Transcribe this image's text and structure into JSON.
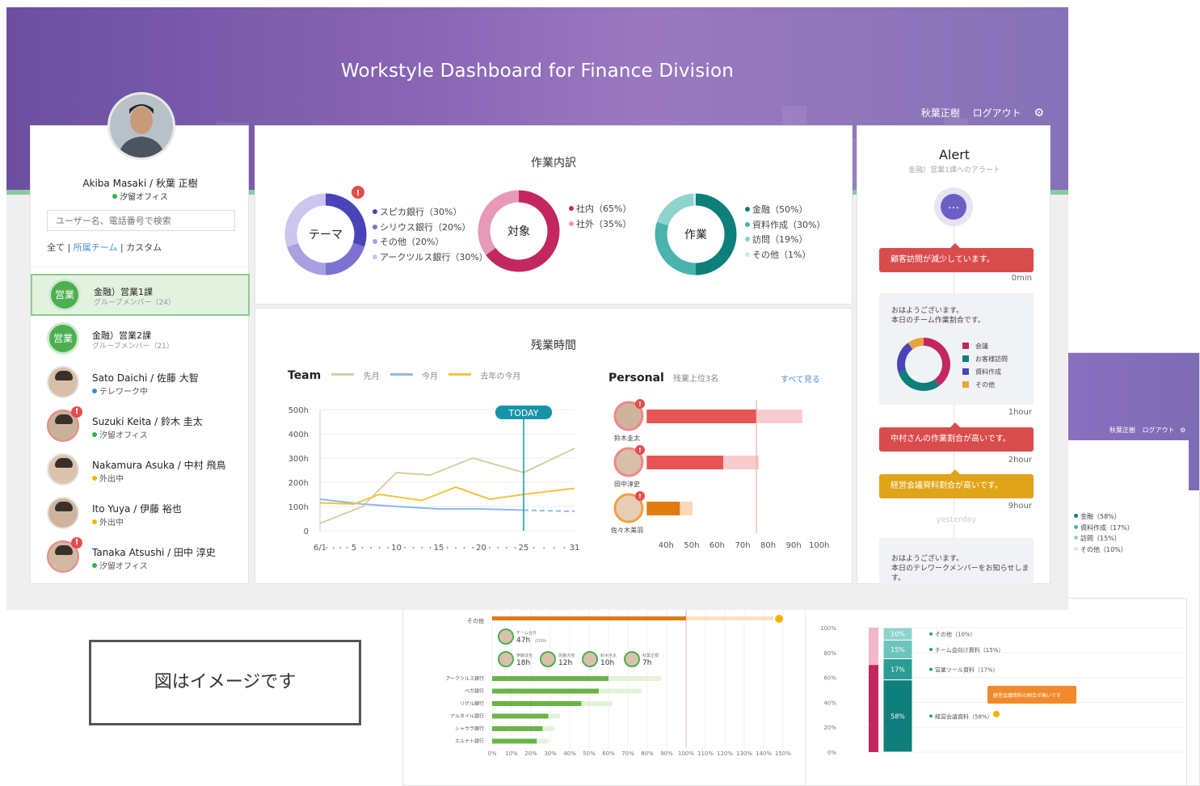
{
  "header": {
    "title": "Workstyle Dashboard for Finance Division",
    "user_name": "秋葉正樹",
    "logout": "ログアウト"
  },
  "profile": {
    "name": "Akiba Masaki / 秋葉 正樹",
    "status": "汐留オフィス",
    "search_placeholder": "ユーザー名、電話番号で検索",
    "filter_all": "全て",
    "filter_team": "所属チーム",
    "filter_custom": "カスタム",
    "sep": "|"
  },
  "groups": [
    {
      "icon": "営業",
      "name": "金融）営業1課",
      "members": "グループメンバー（24）"
    },
    {
      "icon": "営業",
      "name": "金融）営業2課",
      "members": "グループメンバー（21）"
    }
  ],
  "users": [
    {
      "name": "Sato Daichi / 佐藤 大智",
      "status": "テレワーク中",
      "status_color": "#2f8fd8",
      "alert": false
    },
    {
      "name": "Suzuki Keita / 鈴木 圭太",
      "status": "汐留オフィス",
      "status_color": "#2fb34a",
      "alert": true
    },
    {
      "name": "Nakamura Asuka / 中村 飛鳥",
      "status": "外出中",
      "status_color": "#f0b400",
      "alert": false
    },
    {
      "name": "Ito Yuya / 伊藤 裕也",
      "status": "外出中",
      "status_color": "#f0b400",
      "alert": false
    },
    {
      "name": "Tanaka Atsushi / 田中 淳史",
      "status": "汐留オフィス",
      "status_color": "#2fb34a",
      "alert": true
    }
  ],
  "work": {
    "title": "作業内訳",
    "donuts": [
      {
        "label": "テーマ",
        "alert": "!",
        "legend": [
          "スピカ銀行（30%）",
          "シリウス銀行（20%）",
          "その他（20%）",
          "アークツルス銀行（30%）"
        ],
        "colors": [
          "#4b44b8",
          "#7c72d1",
          "#a8a0e0",
          "#cbc6ee"
        ],
        "values": [
          30,
          20,
          20,
          30
        ]
      },
      {
        "label": "対象",
        "legend": [
          "社内（65%）",
          "社外（35%）"
        ],
        "colors": [
          "#c2275f",
          "#e69ab8"
        ],
        "values": [
          65,
          35
        ]
      },
      {
        "label": "作業",
        "legend": [
          "金融（50%）",
          "資料作成（30%）",
          "訪問（19%）",
          "その他（1%）"
        ],
        "colors": [
          "#0e7f7a",
          "#49b3ac",
          "#8fd3cd",
          "#c9ece8"
        ],
        "values": [
          50,
          30,
          19,
          1
        ]
      }
    ]
  },
  "overtime": {
    "title": "残業時間",
    "team_label": "Team",
    "legend": [
      "先月",
      "今月",
      "去年の今月"
    ],
    "today": "TODAY",
    "personal_label": "Personal",
    "personal_sub": "残業上位3名",
    "see_all": "すべて見る",
    "people": [
      "鈴木圭太",
      "田中淳史",
      "佐々木美羽"
    ],
    "person_alerts": [
      "!",
      "!",
      "!"
    ]
  },
  "chart_data": [
    {
      "type": "line",
      "title": "",
      "x_ticks": [
        "6/1",
        "5",
        "10",
        "15",
        "20",
        "25",
        "31"
      ],
      "y_ticks": [
        "500h",
        "400h",
        "300h",
        "200h",
        "100h",
        "0"
      ],
      "ylim": [
        0,
        500
      ],
      "xlim": [
        1,
        31
      ],
      "today_x": 25,
      "series": [
        {
          "name": "先月",
          "color": "#d5d0a0",
          "x": [
            1,
            6,
            10,
            14,
            19,
            25,
            31
          ],
          "values": [
            30,
            100,
            240,
            230,
            300,
            240,
            340
          ]
        },
        {
          "name": "今月",
          "color": "#8fb8ef",
          "x": [
            1,
            6,
            10,
            15,
            20,
            25
          ],
          "values": [
            130,
            110,
            100,
            90,
            90,
            85
          ],
          "dashed_to": {
            "x": 31,
            "value": 80
          }
        },
        {
          "name": "去年の今月",
          "color": "#f5c242",
          "x": [
            1,
            5,
            8,
            13,
            17,
            21,
            25,
            31
          ],
          "values": [
            115,
            110,
            150,
            125,
            180,
            130,
            150,
            175
          ]
        }
      ]
    },
    {
      "type": "bar",
      "orientation": "horizontal",
      "categories": [
        "鈴木圭太",
        "田中淳史",
        "佐々木美羽"
      ],
      "x_ticks": [
        "40h",
        "50h",
        "60h",
        "70h",
        "80h",
        "90h",
        "100h"
      ],
      "xlim": [
        38,
        102
      ],
      "series": [
        {
          "name": "actual",
          "colors": [
            "#e75454",
            "#e75454",
            "#e07b10"
          ],
          "values": [
            83,
            70,
            53
          ]
        },
        {
          "name": "projection",
          "colors": [
            "#f7cccc",
            "#f7cccc",
            "#fbd9b8"
          ],
          "values": [
            101,
            84,
            58
          ]
        }
      ],
      "reference_x": 83
    }
  ],
  "alert": {
    "title": "Alert",
    "subtitle": "金融）営業1課へのアラート",
    "more": "…",
    "items": [
      {
        "text": "顧客訪問が減少しています。",
        "time": "0min",
        "color": "#d94c4c"
      },
      {
        "text": "中村さんの作業割合が高いです。",
        "time": "2hour",
        "color": "#d94c4c"
      },
      {
        "text": "経営会議資料割合が高いです。",
        "time": "9hour",
        "color": "#e0a418"
      }
    ],
    "card1": {
      "line1": "おはようございます。",
      "line2": "本日のチーム作業割合です。",
      "time": "1hour",
      "legend": [
        "会議",
        "お客様訪問",
        "資料作成",
        "その他"
      ],
      "colors": [
        "#c2275f",
        "#0e7f7a",
        "#4b44b8",
        "#e8a33d"
      ],
      "values": [
        40,
        30,
        20,
        10
      ]
    },
    "divider": "yesterday",
    "card2": {
      "line1": "おはようございます。",
      "line2": "本日のテレワークメンバーをお知らせします。"
    }
  },
  "secondary": {
    "user_name": "秋葉正樹",
    "logout": "ログアウト",
    "legend": [
      "金融（58%）",
      "資料作成（17%）",
      "訪問（15%）",
      "その他（10%）"
    ],
    "legend_colors": [
      "#0e7f7a",
      "#49b3ac",
      "#8fd3cd",
      "#c9ece8"
    ],
    "bar_label_other": "その他",
    "chips": [
      {
        "name": "チーム合計",
        "value": "47h",
        "unit": "/200h"
      },
      {
        "name": "伊藤達也",
        "value": "18h"
      },
      {
        "name": "佐藤大地",
        "value": "12h"
      },
      {
        "name": "鈴木圭太",
        "value": "10h"
      },
      {
        "name": "秋葉正樹",
        "value": "7h"
      }
    ],
    "hbars": [
      {
        "label": "アークツルス銀行",
        "value": 60,
        "bg": 87
      },
      {
        "label": "ベガ銀行",
        "value": 55,
        "bg": 77
      },
      {
        "label": "リゲル銀行",
        "value": 46,
        "bg": 62
      },
      {
        "label": "アルタイル銀行",
        "value": 29,
        "bg": 35
      },
      {
        "label": "シャウラ銀行",
        "value": 26,
        "bg": 32
      },
      {
        "label": "エルナト銀行",
        "value": 23,
        "bg": 29
      }
    ],
    "hbar_ticks": [
      "0%",
      "10%",
      "20%",
      "30%",
      "40%",
      "50%",
      "60%",
      "70%",
      "80%",
      "90%",
      "100%",
      "110%",
      "120%",
      "130%",
      "140%",
      "150%"
    ],
    "stack_ticks": [
      "100%",
      "80%",
      "60%",
      "40%",
      "20%",
      "0%"
    ],
    "stack_values": [
      "10%",
      "15%",
      "17%",
      "58%"
    ],
    "stack_legend": [
      "その他（10%）",
      "チーム会向け資料（15%）",
      "営業ツール資料（17%）",
      "経営会議資料（58%）"
    ],
    "stack_callout": "経営会議資料の割合が高いです"
  },
  "notice": "図はイメージです"
}
